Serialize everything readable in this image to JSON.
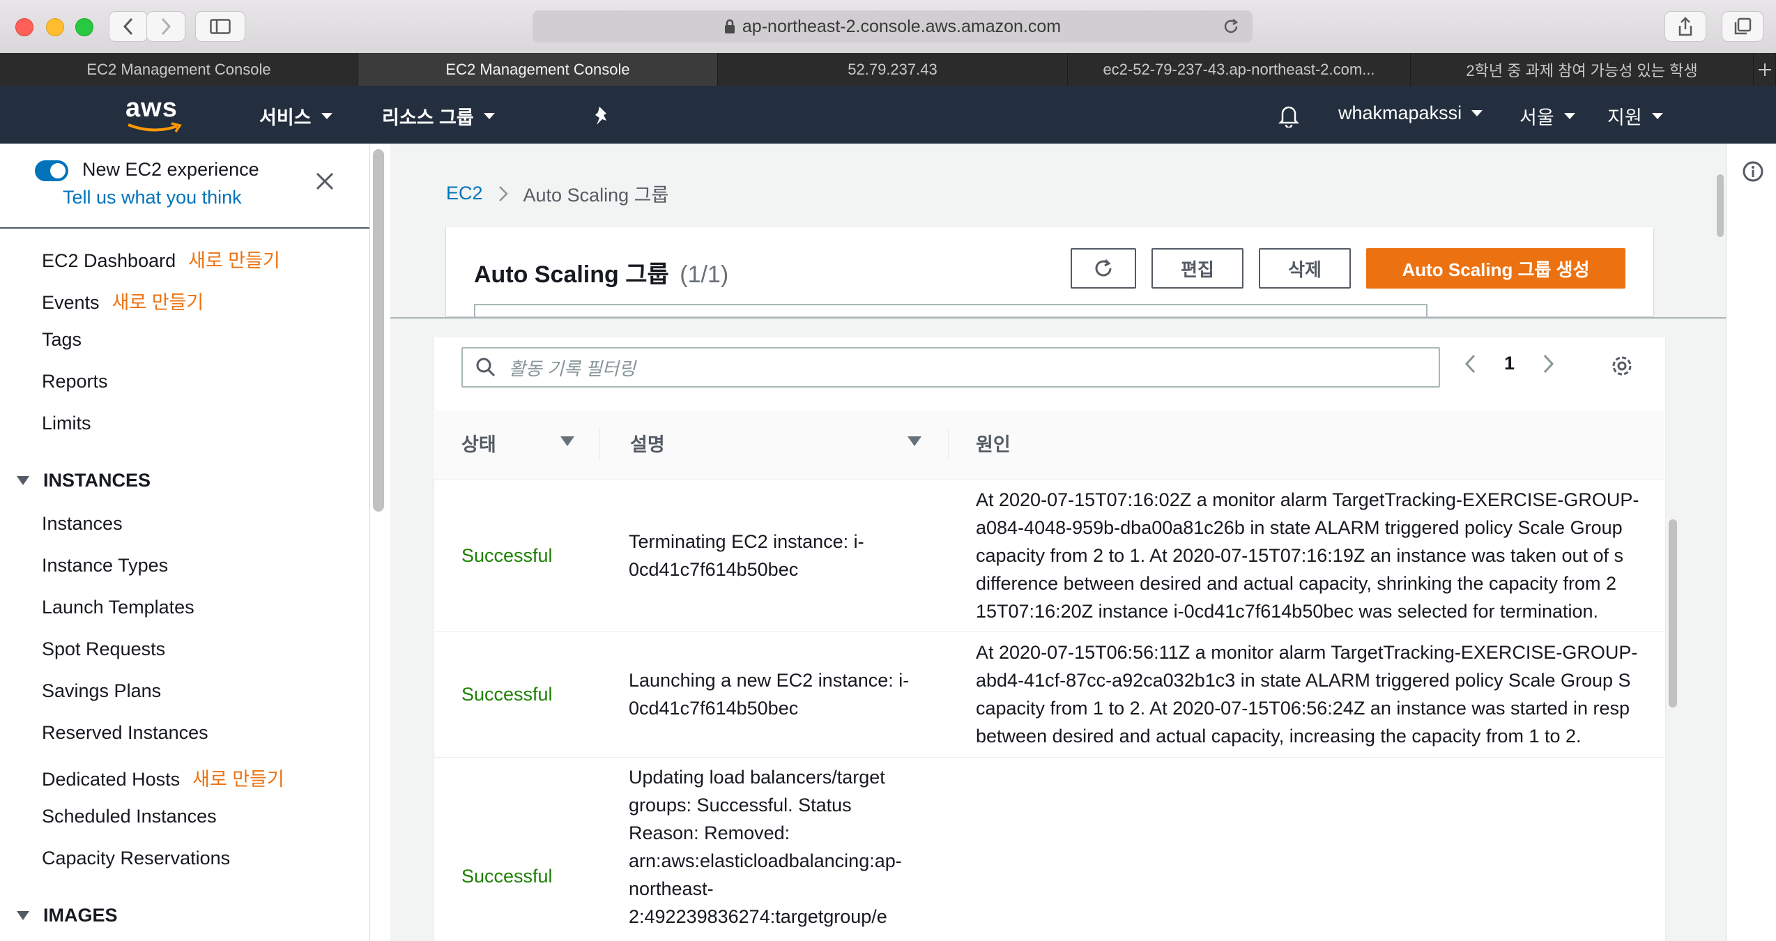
{
  "browser": {
    "url": "ap-northeast-2.console.aws.amazon.com",
    "tabs": [
      {
        "label": "EC2 Management Console"
      },
      {
        "label": "EC2 Management Console"
      },
      {
        "label": "52.79.237.43"
      },
      {
        "label": "ec2-52-79-237-43.ap-northeast-2.com..."
      },
      {
        "label": "2학년 중 과제 참여 가능성 있는 학생"
      }
    ]
  },
  "awsnav": {
    "logo": "aws",
    "services": "서비스",
    "resource_groups": "리소스 그룹",
    "account": "whakmapakssi",
    "region": "서울",
    "support": "지원"
  },
  "sidebar": {
    "toggle_label": "New EC2 experience",
    "feedback_link": "Tell us what you think",
    "new_badge": "새로 만들기",
    "top_links": [
      {
        "label": "EC2 Dashboard",
        "new": "새로 만들기"
      },
      {
        "label": "Events",
        "new": "새로 만들기"
      },
      {
        "label": "Tags",
        "new": ""
      },
      {
        "label": "Reports",
        "new": ""
      },
      {
        "label": "Limits",
        "new": ""
      }
    ],
    "instances_section": "INSTANCES",
    "instances_links": [
      {
        "label": "Instances",
        "new": ""
      },
      {
        "label": "Instance Types",
        "new": ""
      },
      {
        "label": "Launch Templates",
        "new": ""
      },
      {
        "label": "Spot Requests",
        "new": ""
      },
      {
        "label": "Savings Plans",
        "new": ""
      },
      {
        "label": "Reserved Instances",
        "new": ""
      },
      {
        "label": "Dedicated Hosts",
        "new": "새로 만들기"
      },
      {
        "label": "Scheduled Instances",
        "new": ""
      },
      {
        "label": "Capacity Reservations",
        "new": ""
      }
    ],
    "images_section": "IMAGES"
  },
  "breadcrumb": {
    "root": "EC2",
    "current": "Auto Scaling 그룹"
  },
  "header": {
    "title": "Auto Scaling 그룹",
    "count": "(1/1)",
    "edit_label": "편집",
    "delete_label": "삭제",
    "create_label": "Auto Scaling 그룹 생성"
  },
  "activity": {
    "search_placeholder": "활동 기록 필터링",
    "page": "1",
    "columns": {
      "status": "상태",
      "description": "설명",
      "cause": "원인"
    },
    "rows": [
      {
        "status": "Successful",
        "description": [
          "Terminating EC2 instance: i-",
          "0cd41c7f614b50bec"
        ],
        "cause": [
          "At 2020-07-15T07:16:02Z a monitor alarm TargetTracking-EXERCISE-GROUP-",
          "a084-4048-959b-dba00a81c26b in state ALARM triggered policy Scale Group",
          "capacity from 2 to 1. At 2020-07-15T07:16:19Z an instance was taken out of s",
          "difference between desired and actual capacity, shrinking the capacity from 2",
          "15T07:16:20Z instance i-0cd41c7f614b50bec was selected for termination."
        ]
      },
      {
        "status": "Successful",
        "description": [
          "Launching a new EC2 instance: i-",
          "0cd41c7f614b50bec"
        ],
        "cause": [
          "At 2020-07-15T06:56:11Z a monitor alarm TargetTracking-EXERCISE-GROUP-",
          "abd4-41cf-87cc-a92ca032b1c3 in state ALARM triggered policy Scale Group S",
          "capacity from 1 to 2. At 2020-07-15T06:56:24Z an instance was started in resp",
          "between desired and actual capacity, increasing the capacity from 1 to 2."
        ]
      },
      {
        "status": "Successful",
        "description": [
          "Updating load balancers/target",
          "groups: Successful. Status",
          "Reason: Removed:",
          "arn:aws:elasticloadbalancing:ap-",
          "northeast-",
          "2:492239836274:targetgroup/e"
        ],
        "cause": []
      }
    ]
  },
  "colors": {
    "aws_nav": "#232f3e",
    "accent": "#ec7211",
    "link": "#0073bb",
    "success": "#1d8102"
  }
}
